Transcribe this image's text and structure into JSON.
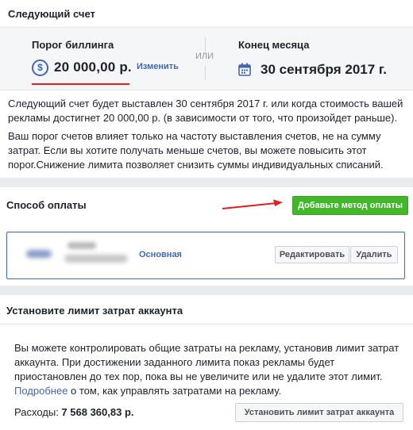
{
  "next_bill": {
    "header": "Следующий счет",
    "threshold_label": "Порог биллинга",
    "threshold_value": "20 000,00 р.",
    "change_link": "Изменить",
    "or_label": "ИЛИ",
    "month_end_label": "Конец месяца",
    "month_end_date": "30 сентября 2017 г.",
    "paragraph1": "Следующий счет будет выставлен 30 сентября 2017 г. или когда стоимость вашей рекламы достигнет 20 000,00 р. (в зависимости от того, что произойдет раньше).",
    "paragraph2": "Ваш порог счетов влияет только на частоту выставления счетов, не на сумму затрат. Если вы хотите получать меньше счетов, вы можете повысить этот порог.Снижение лимита позволяет снизить суммы индивидуальных списаний."
  },
  "payment_method": {
    "header": "Способ оплаты",
    "add_button": "Добавьте метод оплаты",
    "primary_label": "Основная",
    "edit_button": "Редактировать",
    "delete_button": "Удалить"
  },
  "spend_limit": {
    "header": "Установите лимит затрат аккаунта",
    "text_before_link": "Вы можете контролировать общие затраты на рекламу, установив лимит затрат аккаунта. При достижении заданного лимита показ рекламы будет приостановлен до тех пор, пока вы не увеличите или не удалите этот лимит. ",
    "link": "Подробнее",
    "text_after_link": " о том, как управлять затратами на рекламу.",
    "spent_label": "Расходы: ",
    "spent_value": "7 568 360,83 р.",
    "set_button": "Установить лимит затрат аккаунта"
  },
  "colors": {
    "accent": "#4267b2",
    "green": "#42b72a",
    "red_annotation": "#e02020"
  }
}
